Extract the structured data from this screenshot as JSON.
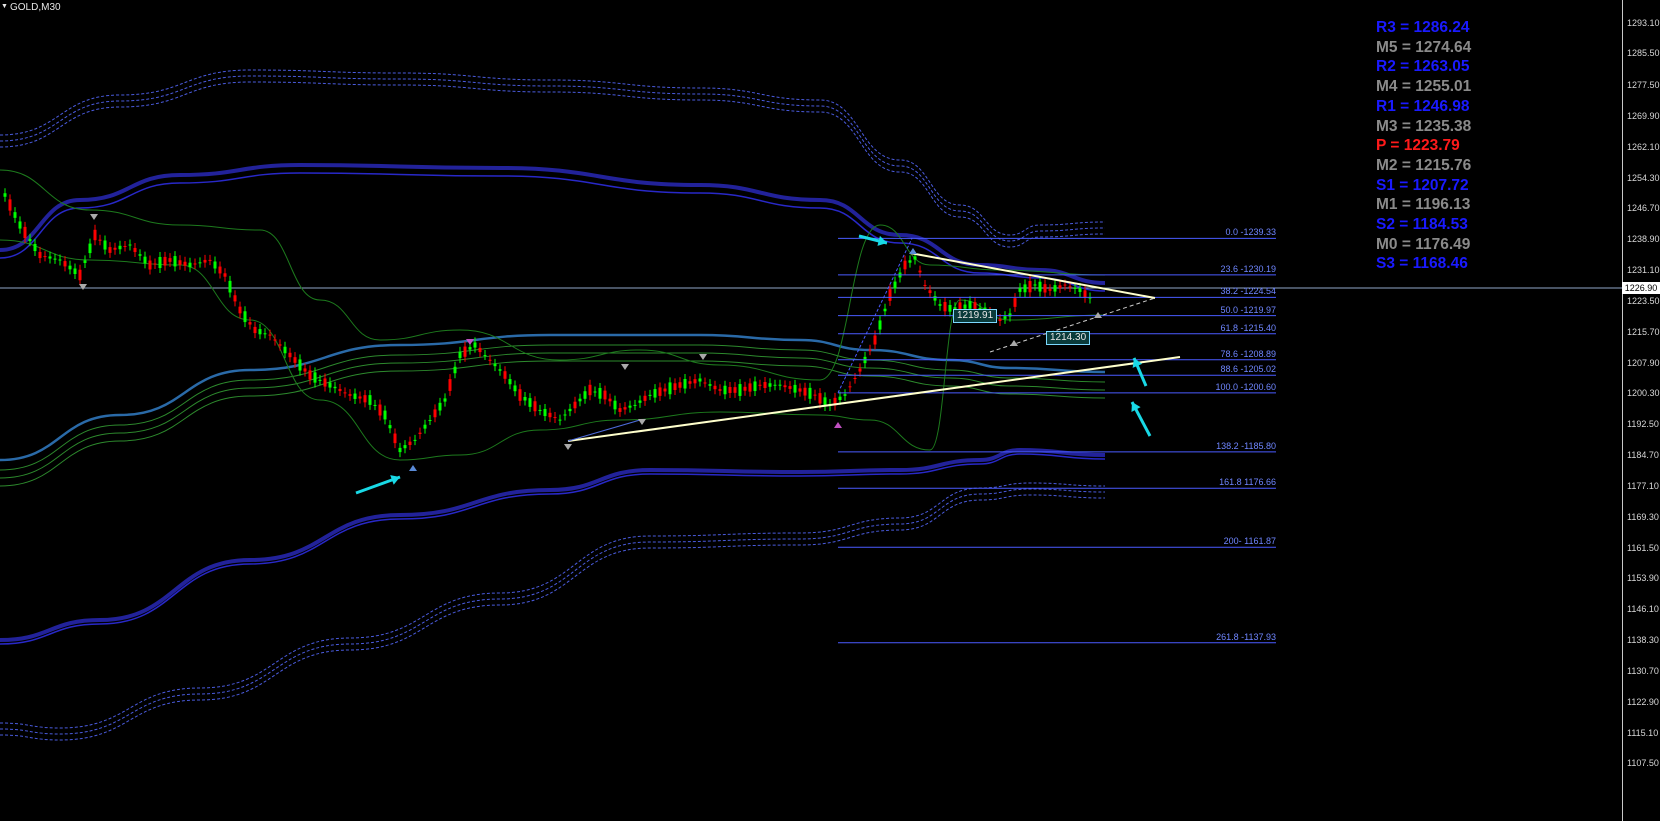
{
  "window": {
    "title": "GOLD,M30"
  },
  "pivot_levels": [
    {
      "name": "R3",
      "value": "1286.24",
      "color": "#1a1aff"
    },
    {
      "name": "M5",
      "value": "1274.64",
      "color": "#8a8a8a"
    },
    {
      "name": "R2",
      "value": "1263.05",
      "color": "#1a1aff"
    },
    {
      "name": "M4",
      "value": "1255.01",
      "color": "#8a8a8a"
    },
    {
      "name": "R1",
      "value": "1246.98",
      "color": "#1a1aff"
    },
    {
      "name": "M3",
      "value": "1235.38",
      "color": "#8a8a8a"
    },
    {
      "name": "P ",
      "value": "1223.79",
      "color": "#ff1a1a"
    },
    {
      "name": "M2",
      "value": "1215.76",
      "color": "#8a8a8a"
    },
    {
      "name": "S1",
      "value": "1207.72",
      "color": "#1a1aff"
    },
    {
      "name": "M1",
      "value": "1196.13",
      "color": "#8a8a8a"
    },
    {
      "name": "S2",
      "value": "1184.53",
      "color": "#1a1aff"
    },
    {
      "name": "M0",
      "value": "1176.49",
      "color": "#8a8a8a"
    },
    {
      "name": "S3",
      "value": "1168.46",
      "color": "#1a1aff"
    }
  ],
  "price_axis": {
    "ticks": [
      "1293.10",
      "1285.50",
      "1277.50",
      "1269.90",
      "1262.10",
      "1254.30",
      "1246.70",
      "1238.90",
      "1231.10",
      "1223.50",
      "1215.70",
      "1207.90",
      "1200.30",
      "1192.50",
      "1184.70",
      "1177.10",
      "1169.30",
      "1161.50",
      "1153.90",
      "1146.10",
      "1138.30",
      "1130.70",
      "1122.90",
      "1115.10",
      "1107.50"
    ],
    "current_price": "1226.90"
  },
  "fib_levels": [
    {
      "label": "0.0 -1239.33",
      "price": 1239.33
    },
    {
      "label": "23.6 -1230.19",
      "price": 1230.19
    },
    {
      "label": "38.2 -1224.54",
      "price": 1224.54
    },
    {
      "label": "50.0 -1219.97",
      "price": 1219.97
    },
    {
      "label": "61.8 -1215.40",
      "price": 1215.4
    },
    {
      "label": "78.6 -1208.89",
      "price": 1208.89
    },
    {
      "label": "88.6 -1205.02",
      "price": 1205.02
    },
    {
      "label": "100.0 -1200.60",
      "price": 1200.6
    },
    {
      "label": "138.2  -1185.80",
      "price": 1185.8
    },
    {
      "label": "161.8 1176.66",
      "price": 1176.66
    },
    {
      "label": "200- 1161.87",
      "price": 1161.87
    },
    {
      "label": "261.8 -1137.93",
      "price": 1137.93
    }
  ],
  "price_tags": [
    {
      "text": "1219.91",
      "price": 1219.91
    },
    {
      "text": "1214.30",
      "price": 1214.3
    }
  ],
  "colors": {
    "bull_candle": "#00ff00",
    "bear_candle": "#ff0000",
    "band_blue": "#1a1acc",
    "band_green": "#2d8a2d",
    "fib_line": "#4a5bff",
    "trendline": "#ffffcc",
    "arrow": "#19d9e6"
  }
}
